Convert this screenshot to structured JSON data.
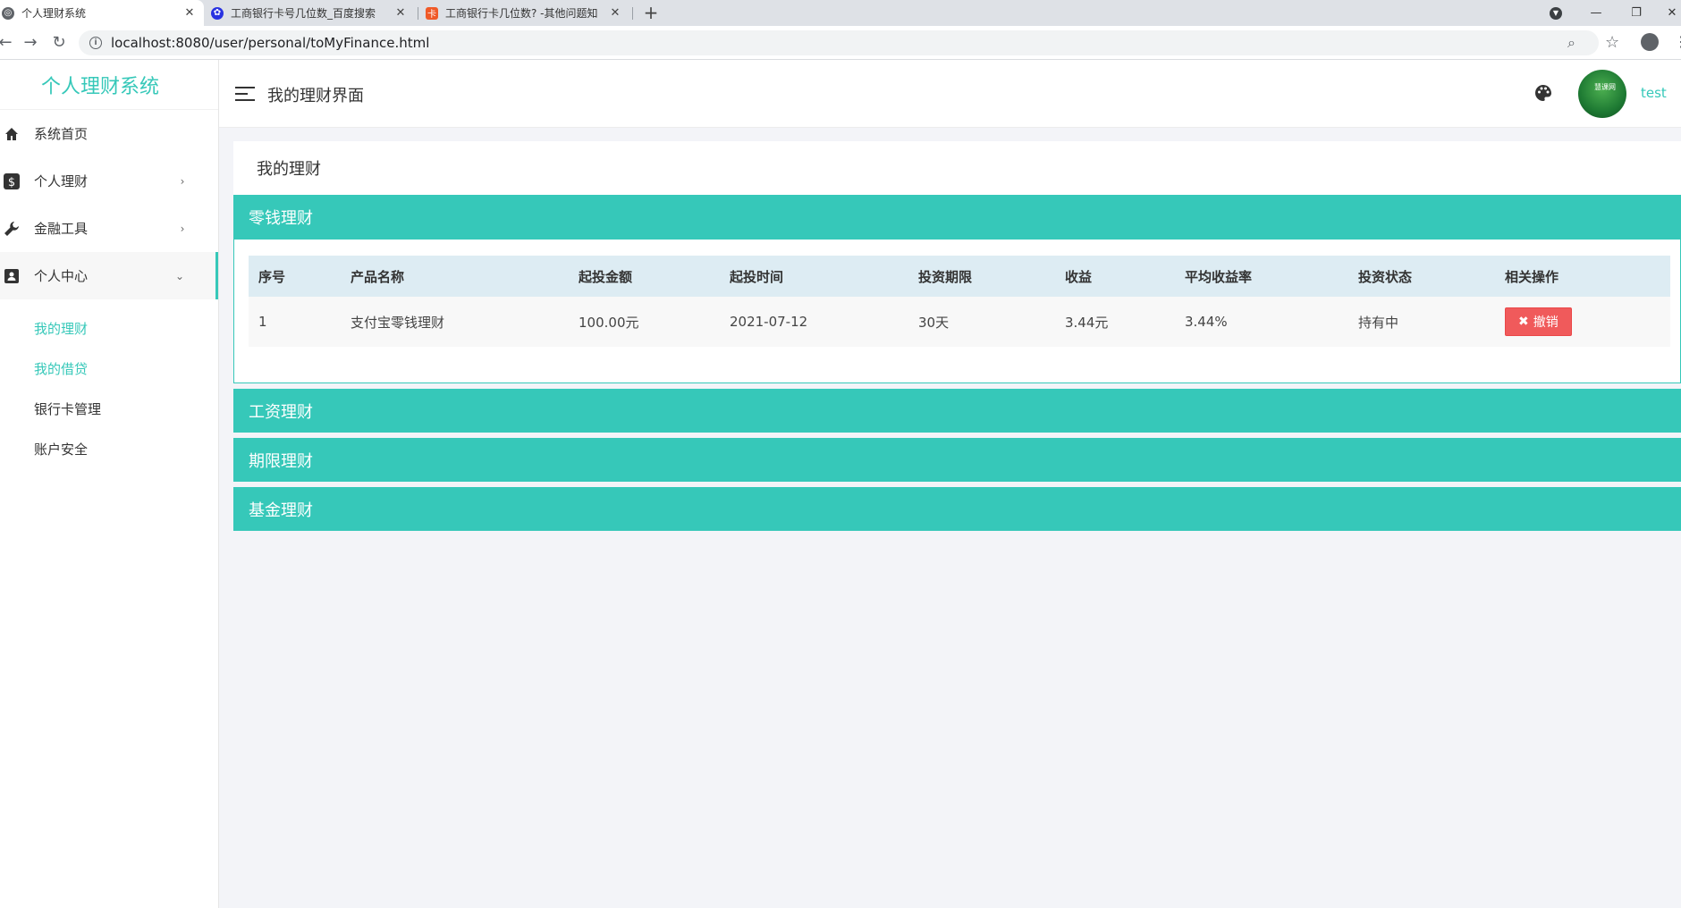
{
  "browser": {
    "tabs": [
      {
        "title": "个人理财系统",
        "icon": "globe-icon",
        "active": true
      },
      {
        "title": "工商银行卡号几位数_百度搜索",
        "icon": "baidu-paw-icon",
        "active": false
      },
      {
        "title": "工商银行卡几位数? -其他问题知",
        "icon": "zhidao-icon",
        "active": false
      }
    ],
    "url": "localhost:8080/user/personal/toMyFinance.html"
  },
  "sidebar": {
    "logo": "个人理财系统",
    "items": [
      {
        "label": "系统首页",
        "icon": "home-icon"
      },
      {
        "label": "个人理财",
        "icon": "dollar-icon",
        "arrow": "›"
      },
      {
        "label": "金融工具",
        "icon": "wrench-icon",
        "arrow": "›"
      },
      {
        "label": "个人中心",
        "icon": "contact-card-icon",
        "arrow": "⌄"
      }
    ],
    "submenu": [
      {
        "label": "我的理财",
        "active": true
      },
      {
        "label": "我的借贷",
        "active": true
      },
      {
        "label": "银行卡管理",
        "active": false
      },
      {
        "label": "账户安全",
        "active": false
      }
    ]
  },
  "header": {
    "title": "我的理财界面",
    "username": "test",
    "avatar_text": "慧课网"
  },
  "main": {
    "page_title": "我的理财",
    "panels": [
      {
        "title": "零钱理财",
        "expanded": true
      },
      {
        "title": "工资理财",
        "expanded": false
      },
      {
        "title": "期限理财",
        "expanded": false
      },
      {
        "title": "基金理财",
        "expanded": false
      }
    ],
    "table": {
      "columns": [
        "序号",
        "产品名称",
        "起投金额",
        "起投时间",
        "投资期限",
        "收益",
        "平均收益率",
        "投资状态",
        "相关操作"
      ],
      "rows": [
        {
          "index": "1",
          "name": "支付宝零钱理财",
          "amount": "100.00元",
          "date": "2021-07-12",
          "period": "30天",
          "income": "3.44元",
          "rate": "3.44%",
          "status": "持有中",
          "action": "撤销"
        }
      ]
    }
  },
  "colors": {
    "accent": "#36c8b9",
    "danger": "#f05a5b",
    "table_header_bg": "#ddecf3"
  }
}
